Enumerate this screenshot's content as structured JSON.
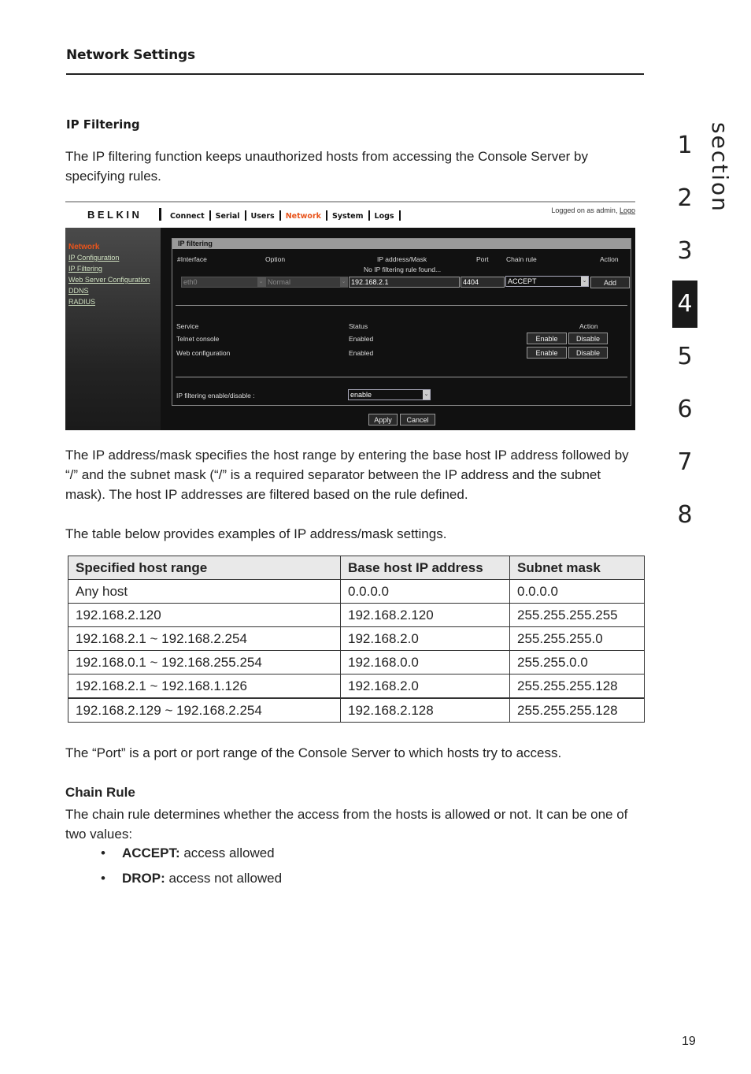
{
  "header": {
    "title": "Network Settings"
  },
  "section_nav": {
    "label": "section",
    "numbers": [
      "1",
      "2",
      "3",
      "4",
      "5",
      "6",
      "7",
      "8"
    ],
    "active": "4"
  },
  "page_number": "19",
  "ip_filtering": {
    "heading": "IP Filtering",
    "intro": "The IP filtering function keeps unauthorized hosts from accessing the Console Server by specifying rules."
  },
  "screenshot": {
    "logo": "BELKIN",
    "nav": [
      "Connect",
      "Serial",
      "Users",
      "Network",
      "System",
      "Logs"
    ],
    "nav_active": "Network",
    "logged_text": "Logged on as admin,",
    "logout_label": "Logo",
    "sidebar": {
      "title": "Network",
      "links": [
        "IP Configuration",
        "IP Filtering",
        "Web Server Configuration",
        "DDNS",
        "RADIUS"
      ]
    },
    "panel_title": "IP filtering",
    "rule_headers": {
      "interface": "#Interface",
      "option": "Option",
      "ip_mask": "IP address/Mask",
      "port": "Port",
      "chain_rule": "Chain rule",
      "action": "Action"
    },
    "no_rule_msg": "No IP filtering rule found...",
    "inputs": {
      "interface": "eth0",
      "option": "Normal",
      "ip_mask": "192.168.2.1",
      "port": "4404",
      "chain_rule": "ACCEPT"
    },
    "add_label": "Add",
    "service_headers": {
      "service": "Service",
      "status": "Status",
      "action": "Action"
    },
    "services": [
      {
        "name": "Telnet console",
        "status": "Enabled"
      },
      {
        "name": "Web configuration",
        "status": "Enabled"
      }
    ],
    "enable_label": "Enable",
    "disable_label": "Disable",
    "toggle_label": "IP filtering enable/disable :",
    "toggle_value": "enable",
    "apply_label": "Apply",
    "cancel_label": "Cancel"
  },
  "ipmask_desc": "The IP address/mask specifies the host range by entering the base host IP address followed by “/” and the subnet mask (“/” is a required separator between the IP address and the subnet mask). The host IP addresses are filtered based on the rule defined.",
  "table_intro": "The table below provides examples of IP address/mask settings.",
  "table": {
    "headers": [
      "Specified host range",
      "Base host IP address",
      "Subnet mask"
    ],
    "rows": [
      [
        "Any host",
        "0.0.0.0",
        "0.0.0.0"
      ],
      [
        "192.168.2.120",
        "192.168.2.120",
        "255.255.255.255"
      ],
      [
        "192.168.2.1 ~ 192.168.2.254",
        "192.168.2.0",
        "255.255.255.0"
      ],
      [
        "192.168.0.1 ~ 192.168.255.254",
        "192.168.0.0",
        "255.255.0.0"
      ],
      [
        "192.168.2.1 ~ 192.168.1.126",
        "192.168.2.0",
        "255.255.255.128"
      ],
      [
        "192.168.2.129 ~ 192.168.2.254",
        "192.168.2.128",
        "255.255.255.128"
      ]
    ]
  },
  "port_desc": "The “Port” is a port or port range of the Console Server to which hosts try to access.",
  "chain_rule": {
    "heading": "Chain Rule",
    "desc": "The chain rule determines whether the access from the hosts is allowed or not. It can be one of two values:",
    "items": [
      {
        "term": "ACCEPT:",
        "desc": " access allowed"
      },
      {
        "term": "DROP:",
        "desc": " access not allowed"
      }
    ]
  }
}
